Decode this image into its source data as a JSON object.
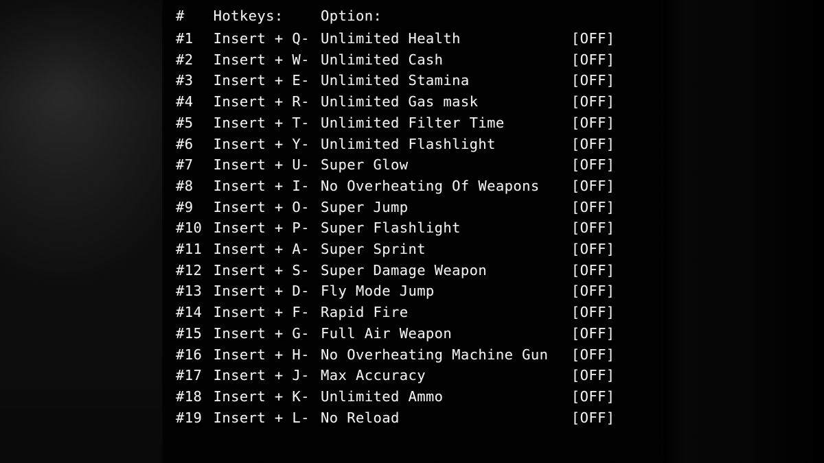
{
  "overlay": {
    "title": "Trainer hotkey list overlay",
    "text_color": "#f4f4f4",
    "panel_color": "#010101",
    "backdrop_color": "#0d0d0d"
  },
  "table": {
    "headers": {
      "number": "#",
      "hotkeys": "Hotkeys:",
      "option": "Option:",
      "state": ""
    },
    "rows": [
      {
        "num": "#1",
        "hotkey": "Insert + Q-",
        "option": "Unlimited Health",
        "state": "[OFF]"
      },
      {
        "num": "#2",
        "hotkey": "Insert + W-",
        "option": "Unlimited Cash",
        "state": "[OFF]"
      },
      {
        "num": "#3",
        "hotkey": "Insert + E-",
        "option": "Unlimited Stamina",
        "state": "[OFF]"
      },
      {
        "num": "#4",
        "hotkey": "Insert + R-",
        "option": "Unlimited Gas mask",
        "state": "[OFF]"
      },
      {
        "num": "#5",
        "hotkey": "Insert + T-",
        "option": "Unlimited Filter Time",
        "state": "[OFF]"
      },
      {
        "num": "#6",
        "hotkey": "Insert + Y-",
        "option": "Unlimited Flashlight",
        "state": "[OFF]"
      },
      {
        "num": "#7",
        "hotkey": "Insert + U-",
        "option": "Super Glow",
        "state": "[OFF]"
      },
      {
        "num": "#8",
        "hotkey": "Insert + I-",
        "option": "No Overheating Of Weapons",
        "state": "[OFF]"
      },
      {
        "num": "#9",
        "hotkey": "Insert + O-",
        "option": "Super Jump",
        "state": "[OFF]"
      },
      {
        "num": "#10",
        "hotkey": "Insert + P-",
        "option": "Super Flashlight",
        "state": "[OFF]"
      },
      {
        "num": "#11",
        "hotkey": "Insert + A-",
        "option": "Super Sprint",
        "state": "[OFF]"
      },
      {
        "num": "#12",
        "hotkey": "Insert + S-",
        "option": "Super Damage Weapon",
        "state": "[OFF]"
      },
      {
        "num": "#13",
        "hotkey": "Insert + D-",
        "option": "Fly Mode Jump",
        "state": "[OFF]"
      },
      {
        "num": "#14",
        "hotkey": "Insert + F-",
        "option": "Rapid Fire",
        "state": "[OFF]"
      },
      {
        "num": "#15",
        "hotkey": "Insert + G-",
        "option": "Full Air Weapon",
        "state": "[OFF]"
      },
      {
        "num": "#16",
        "hotkey": "Insert + H-",
        "option": "No Overheating Machine Gun",
        "state": "[OFF]"
      },
      {
        "num": "#17",
        "hotkey": "Insert + J-",
        "option": "Max Accuracy",
        "state": "[OFF]"
      },
      {
        "num": "#18",
        "hotkey": "Insert + K-",
        "option": "Unlimited Ammo",
        "state": "[OFF]"
      },
      {
        "num": "#19",
        "hotkey": "Insert + L-",
        "option": "No Reload",
        "state": "[OFF]"
      }
    ]
  }
}
